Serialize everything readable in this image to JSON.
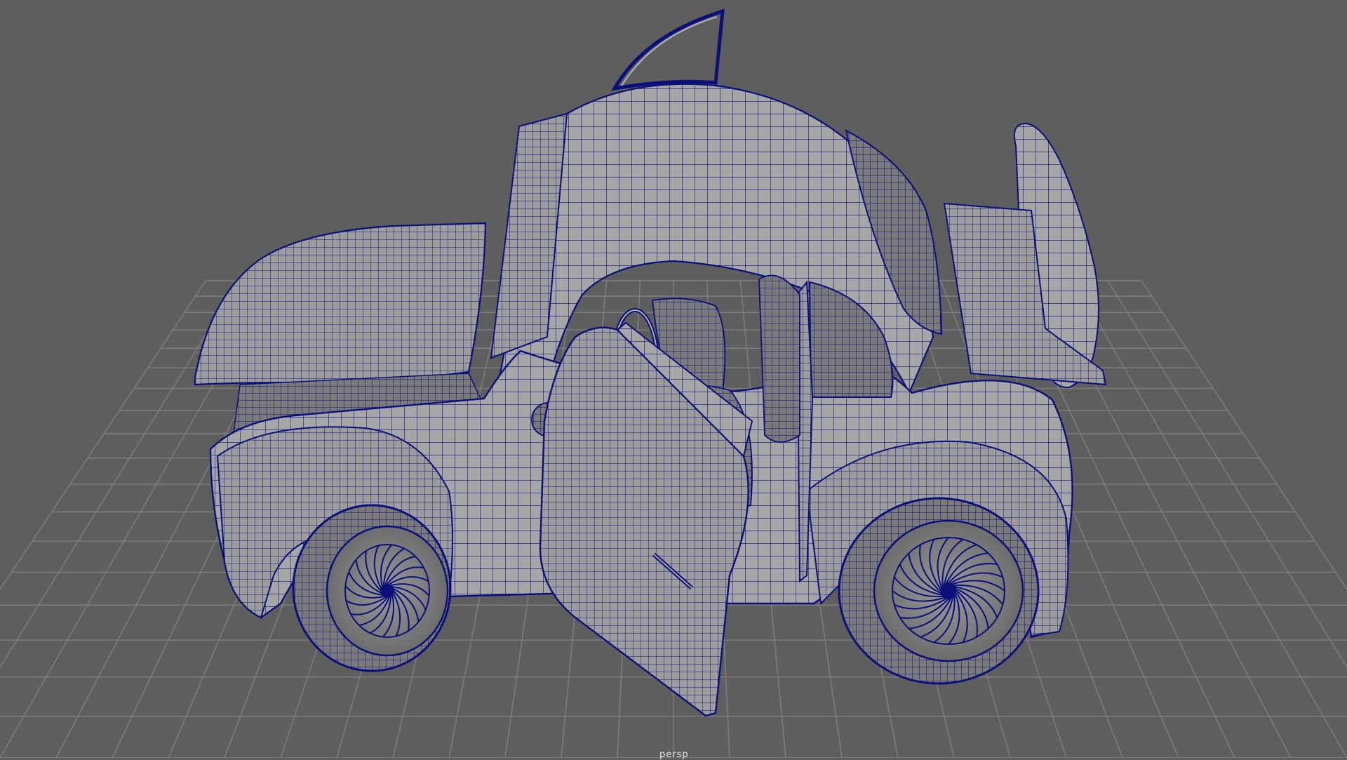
{
  "viewport": {
    "camera_label": "persp",
    "colors": {
      "background": "#5e5e5e",
      "grid": "#7d7d7d",
      "wire": "#0c0f7a",
      "surface": "#a4a4a4",
      "surface_dark": "#8e8e8e",
      "interior": "#6f6f6f"
    }
  },
  "scene": {
    "object": "car-model",
    "display_mode": "wireframe-on-shaded"
  }
}
